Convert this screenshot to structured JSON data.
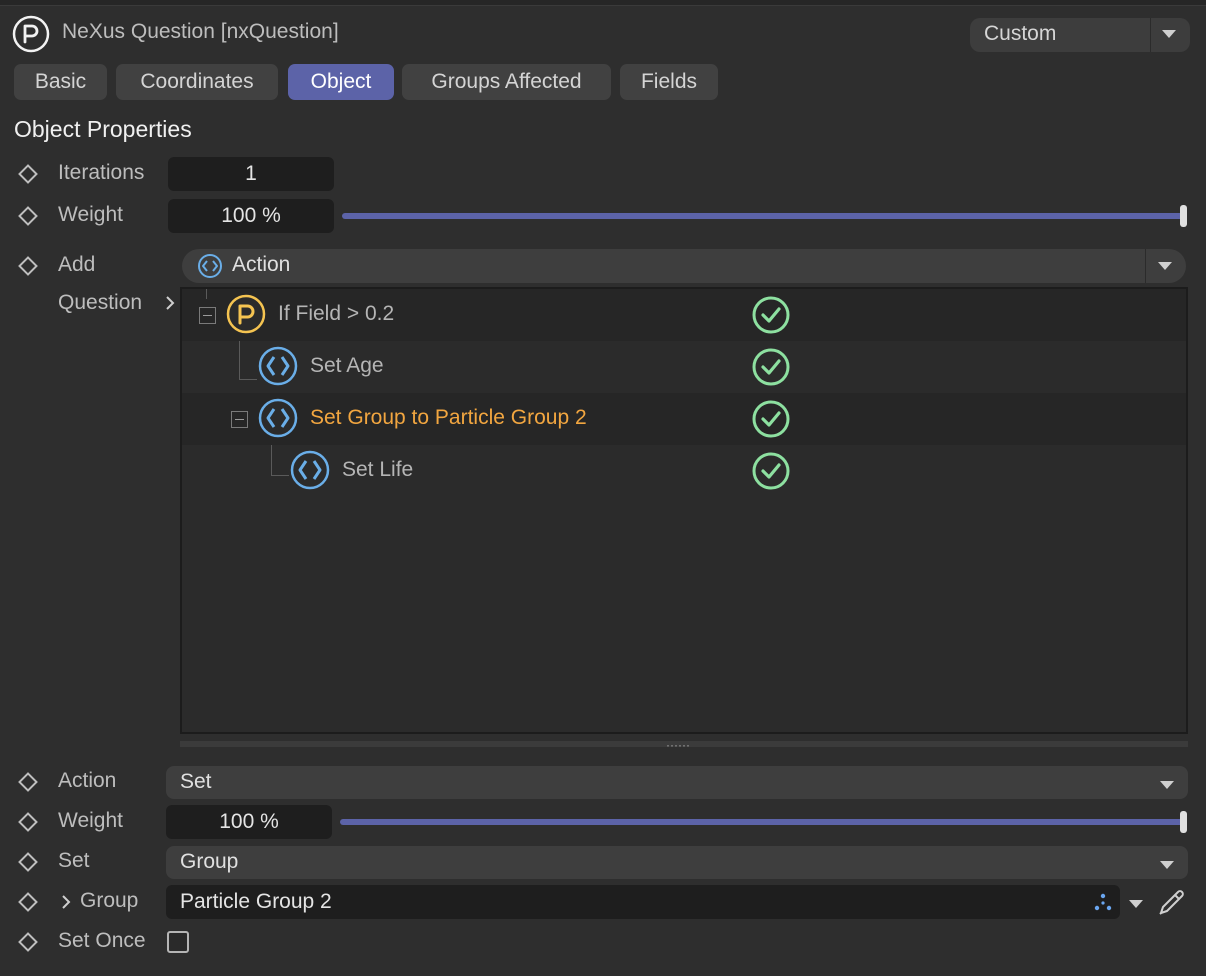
{
  "header": {
    "title": "NeXus Question [nxQuestion]",
    "preset": "Custom"
  },
  "tabs": [
    {
      "label": "Basic",
      "active": false
    },
    {
      "label": "Coordinates",
      "active": false
    },
    {
      "label": "Object",
      "active": true
    },
    {
      "label": "Groups Affected",
      "active": false
    },
    {
      "label": "Fields",
      "active": false
    }
  ],
  "section_title": "Object Properties",
  "props": {
    "iterations_label": "Iterations",
    "iterations_value": "1",
    "weight_label": "Weight",
    "weight_value": "100 %",
    "weight_fraction": 1.0,
    "add_label": "Add",
    "add_value": "Action",
    "question_label": "Question"
  },
  "tree": {
    "items": [
      {
        "label": "If Field > 0.2",
        "icon": "question-icon",
        "enabled": true,
        "selected": false
      },
      {
        "label": "Set Age",
        "icon": "action-icon",
        "enabled": true,
        "selected": false
      },
      {
        "label": "Set Group to Particle Group 2",
        "icon": "action-icon",
        "enabled": true,
        "selected": true
      },
      {
        "label": "Set Life",
        "icon": "action-icon",
        "enabled": true,
        "selected": false
      }
    ]
  },
  "action_props": {
    "action_label": "Action",
    "action_value": "Set",
    "weight_label": "Weight",
    "weight_value": "100 %",
    "weight_fraction": 1.0,
    "set_label": "Set",
    "set_value": "Group",
    "group_label": "Group",
    "group_value": "Particle Group 2",
    "set_once_label": "Set Once",
    "set_once_checked": false
  },
  "colors": {
    "accent": "#5c63a8",
    "selected_text": "#f2a640",
    "question_icon": "#f5c451",
    "action_icon": "#6aaee8",
    "check_icon": "#8de0a0"
  }
}
